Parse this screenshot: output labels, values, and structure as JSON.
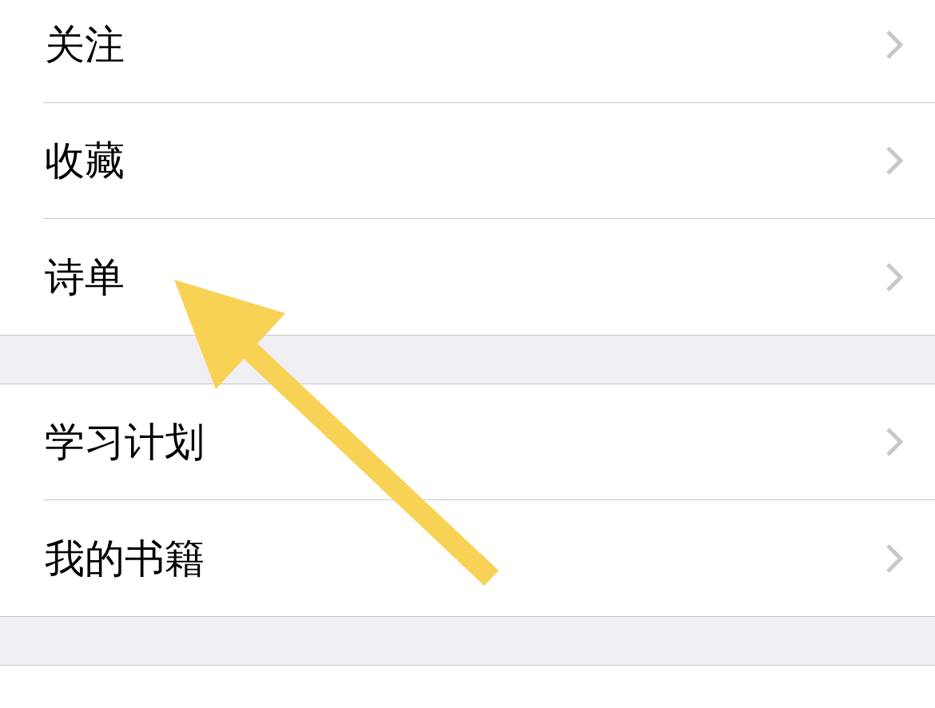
{
  "groups": [
    {
      "items": [
        {
          "label": "关注"
        },
        {
          "label": "收藏"
        },
        {
          "label": "诗单"
        }
      ]
    },
    {
      "items": [
        {
          "label": "学习计划"
        },
        {
          "label": "我的书籍"
        }
      ]
    }
  ]
}
